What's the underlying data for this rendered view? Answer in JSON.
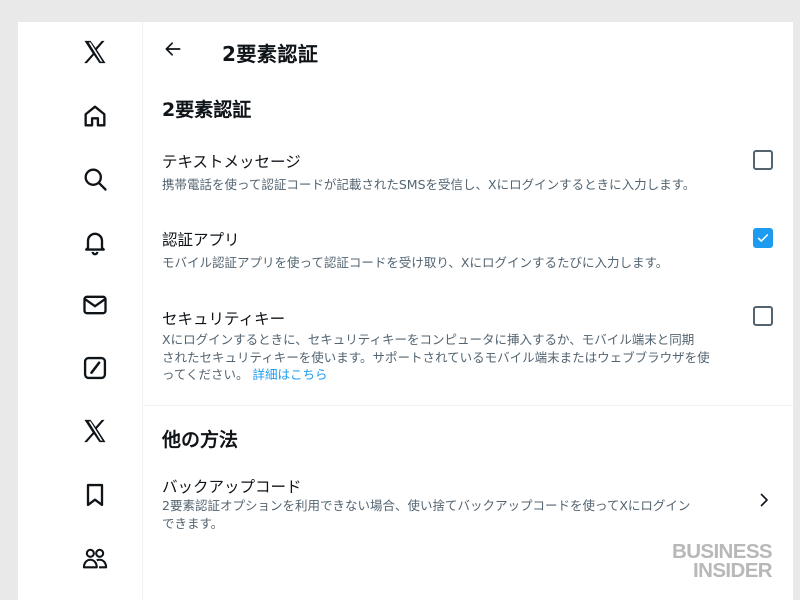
{
  "header": {
    "title": "2要素認証"
  },
  "sidebar": {
    "items": [
      {
        "icon": "x-logo-icon"
      },
      {
        "icon": "home-icon"
      },
      {
        "icon": "search-icon"
      },
      {
        "icon": "bell-icon"
      },
      {
        "icon": "mail-icon"
      },
      {
        "icon": "grok-icon"
      },
      {
        "icon": "x-premium-icon"
      },
      {
        "icon": "bookmark-icon"
      },
      {
        "icon": "communities-icon"
      }
    ]
  },
  "main": {
    "section1_title": "2要素認証",
    "options": [
      {
        "title": "テキストメッセージ",
        "desc": "携帯電話を使って認証コードが記載されたSMSを受信し、Xにログインするときに入力します。",
        "checked": false
      },
      {
        "title": "認証アプリ",
        "desc": "モバイル認証アプリを使って認証コードを受け取り、Xにログインするたびに入力します。",
        "checked": true
      },
      {
        "title": "セキュリティキー",
        "desc_line1": "Xにログインするときに、セキュリティキーをコンピュータに挿入するか、モバイル端末と同期",
        "desc_line2": "されたセキュリティキーを使います。サポートされているモバイル端末またはウェブブラウザを使",
        "desc_line3": "ってください。",
        "link": "詳細はこちら",
        "checked": false
      }
    ],
    "section2_title": "他の方法",
    "backup": {
      "title": "バックアップコード",
      "desc_line1": "2要素認証オプションを利用できない場合、使い捨てバックアップコードを使ってXにログイン",
      "desc_line2": "できます。"
    }
  },
  "watermark": {
    "line1": "BUSINESS",
    "line2": "INSIDER"
  },
  "colors": {
    "accent": "#1d9bf0",
    "text": "#0f1419",
    "secondary": "#536471",
    "divider": "#eff3f4"
  }
}
